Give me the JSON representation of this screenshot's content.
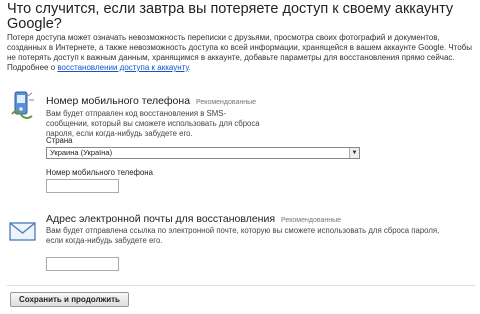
{
  "page": {
    "title": "Что случится, если завтра вы потеряете доступ к своему аккаунту Google?",
    "intro_text": "Потеря доступа может означать невозможность переписки с друзьями, просмотра своих фотографий и документов, созданных в Интернете, а также невозможность доступа ко всей информации, хранящейся в вашем аккаунте Google. Чтобы не потерять доступ к важным данным, хранящимся в аккаунте, добавьте параметры для восстановления прямо сейчас. Подробнее о ",
    "intro_link": "восстановлении доступа к аккаунту",
    "intro_link_suffix": "."
  },
  "phone_section": {
    "icon": "phone-recovery-icon",
    "title": "Номер мобильного телефона",
    "badge": "Рекомендованные",
    "description": "Вам будет отправлен код восстановления в SMS-сообщении, который вы сможете использовать для сброса пароля, если когда-нибудь забудете его.",
    "country_label": "Страна",
    "country_value": "Украина (Україна)",
    "phone_label": "Номер мобильного телефона",
    "phone_value": ""
  },
  "email_section": {
    "icon": "envelope-icon",
    "title": "Адрес электронной почты для восстановления",
    "badge": "Рекомендованные",
    "description": "Вам будет отправлена ссылка по электронной почте, которую вы сможете использовать для сброса пароля, если когда-нибудь забудете его.",
    "email_value": ""
  },
  "actions": {
    "save_label": "Сохранить и продолжить"
  },
  "colors": {
    "link": "#1155cc",
    "icon_blue": "#4a7bbd"
  }
}
